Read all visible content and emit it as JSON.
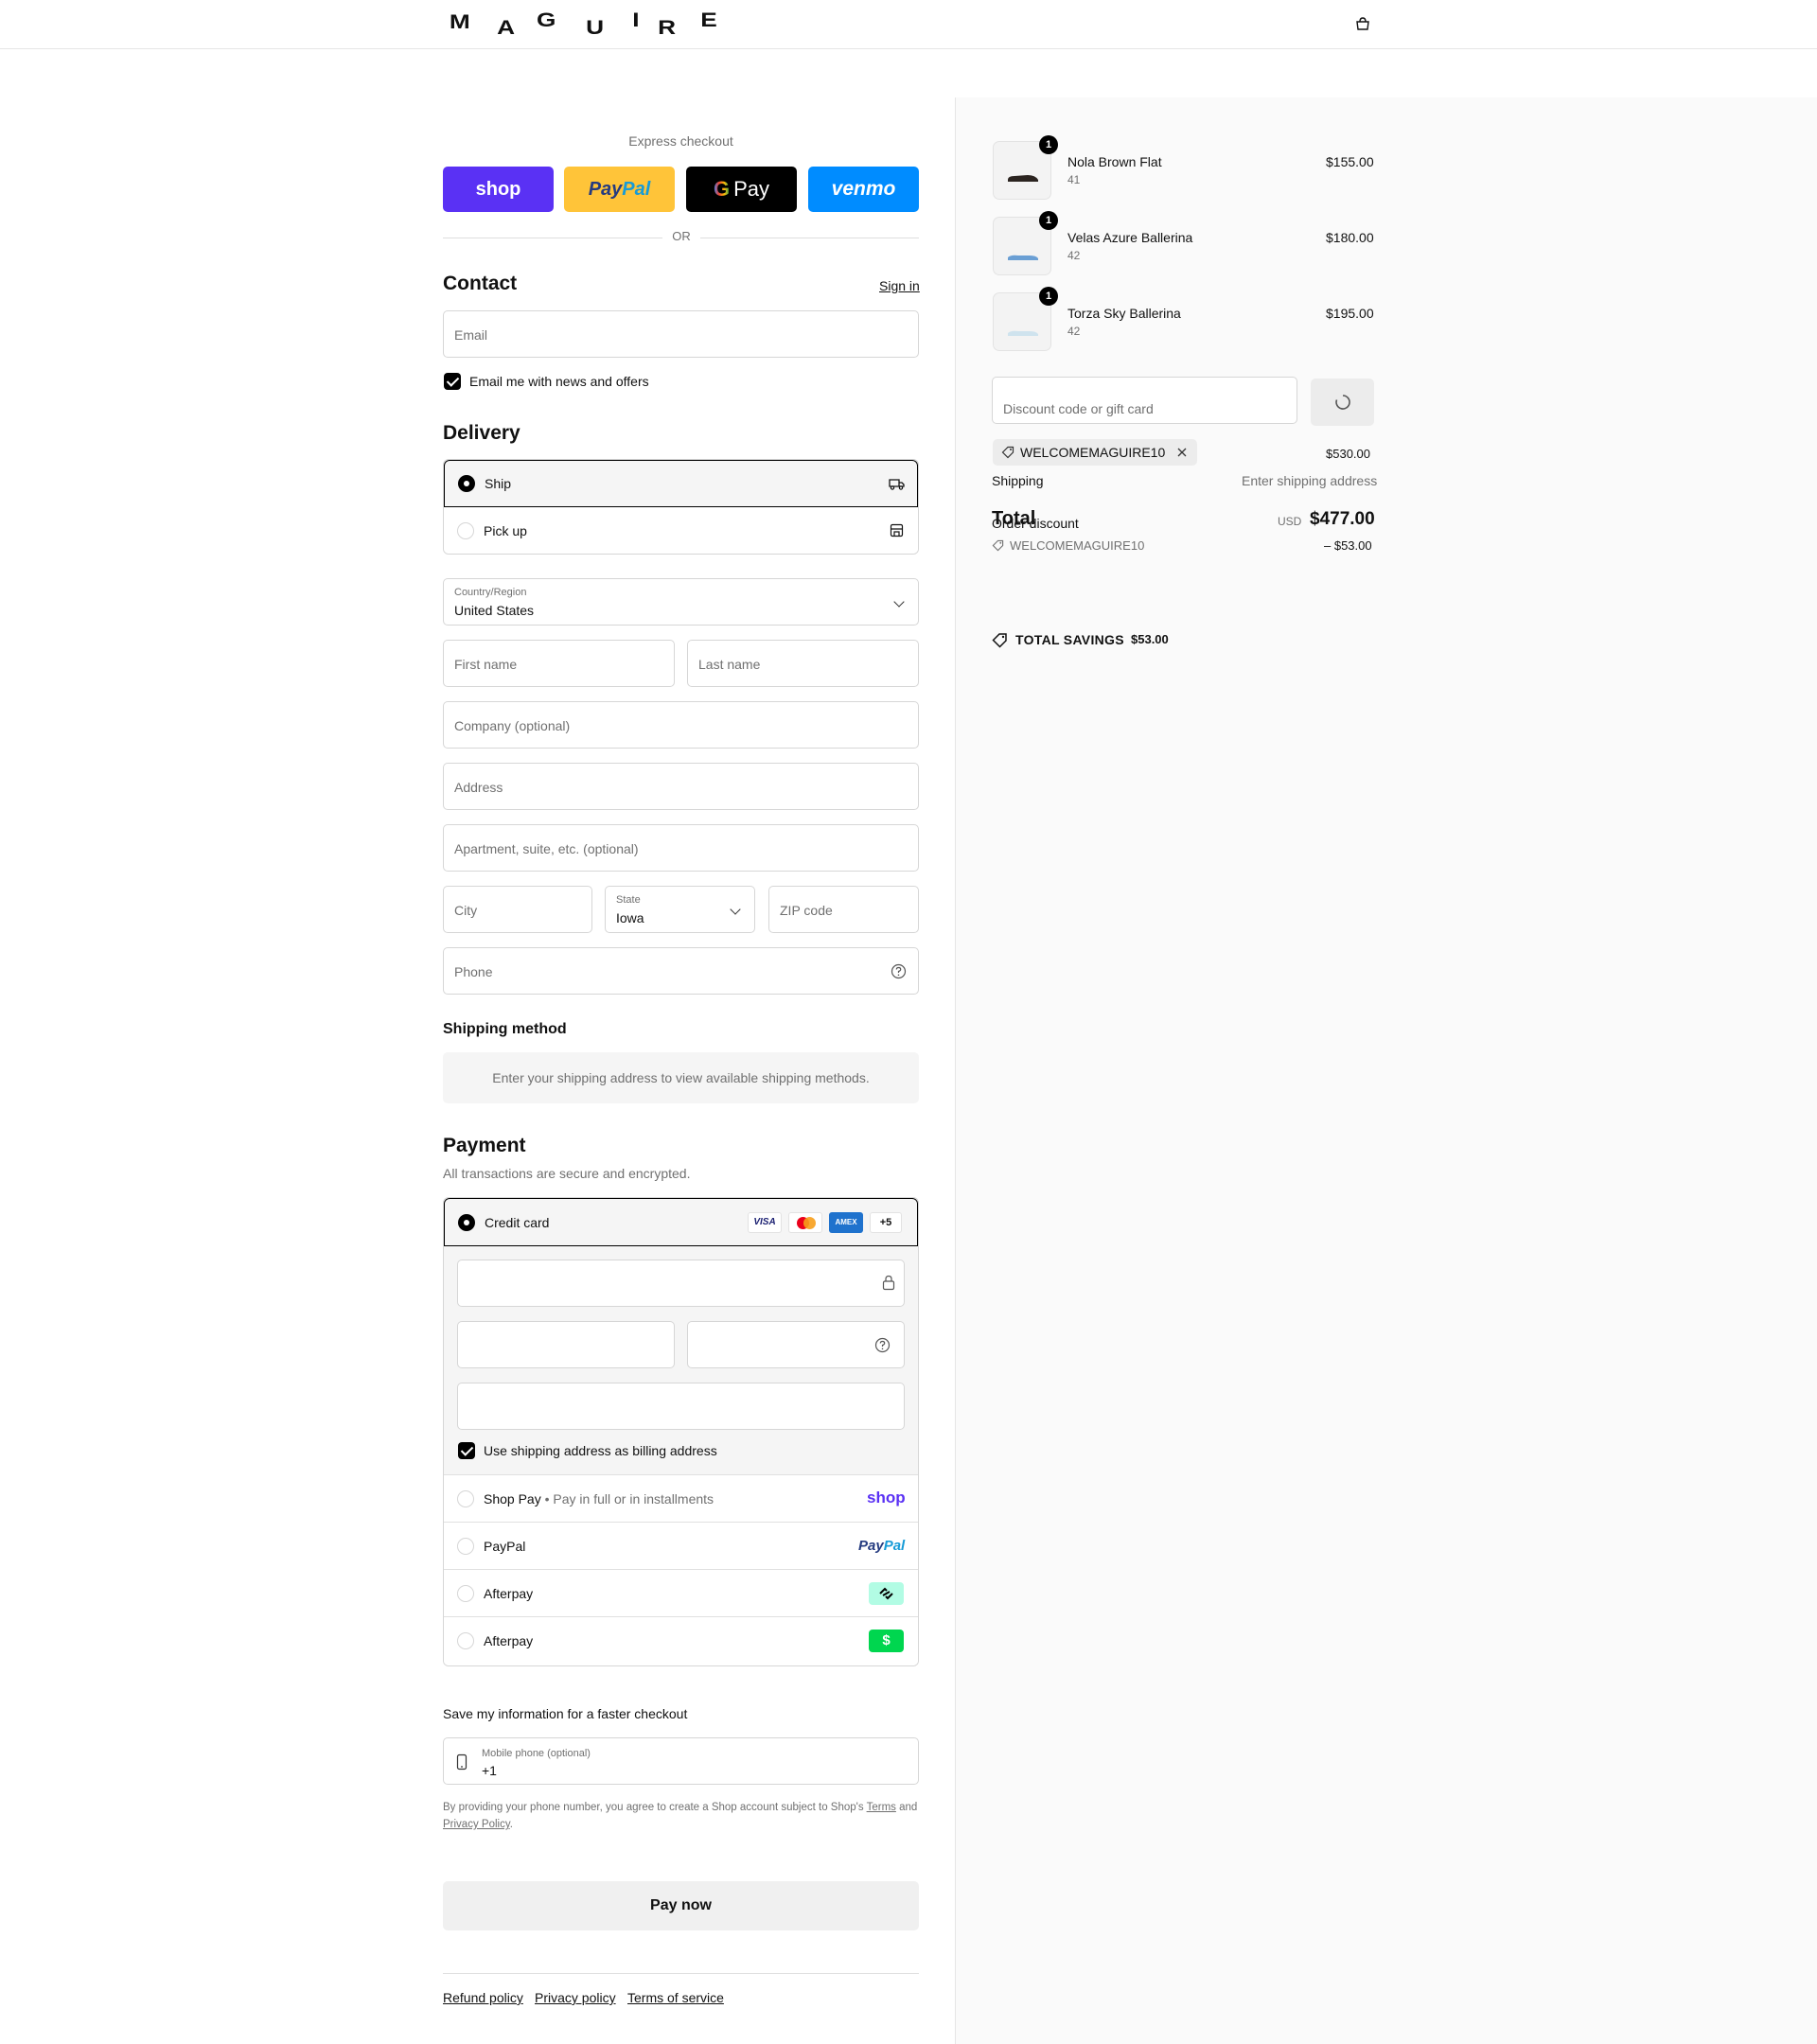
{
  "header": {
    "brand_letters": [
      "M",
      "A",
      "G",
      "U",
      "I",
      "R",
      "E"
    ]
  },
  "express": {
    "title": "Express checkout",
    "shop": "shop",
    "paypal_a": "Pay",
    "paypal_b": "Pal",
    "gpay": "Pay",
    "venmo": "venmo",
    "or": "OR"
  },
  "contact": {
    "title": "Contact",
    "sign_in": "Sign in",
    "email_placeholder": "Email",
    "news_label": "Email me with news and offers"
  },
  "delivery": {
    "title": "Delivery",
    "ship": "Ship",
    "pickup": "Pick up",
    "country_label": "Country/Region",
    "country_value": "United States",
    "first_name": "First name",
    "last_name": "Last name",
    "company": "Company (optional)",
    "address": "Address",
    "apartment": "Apartment, suite, etc. (optional)",
    "city": "City",
    "state_label": "State",
    "state_value": "Iowa",
    "zip": "ZIP code",
    "phone": "Phone"
  },
  "shipping_method": {
    "title": "Shipping method",
    "message": "Enter your shipping address to view available shipping methods."
  },
  "payment": {
    "title": "Payment",
    "subtitle": "All transactions are secure and encrypted.",
    "credit_card": "Credit card",
    "card_visa": "VISA",
    "card_amex": "AMEX",
    "card_more": "+5",
    "billing_same": "Use shipping address as billing address",
    "shop_pay": "Shop Pay",
    "shop_pay_note": "Pay in full or in installments",
    "shop_logo": "shop",
    "paypal": "PayPal",
    "paypal_logo_a": "Pay",
    "paypal_logo_b": "Pal",
    "afterpay_1": "Afterpay",
    "afterpay_2": "Afterpay",
    "cash_logo": "$"
  },
  "save_info": {
    "title": "Save my information for a faster checkout",
    "mobile_label": "Mobile phone (optional)",
    "mobile_value": "+1",
    "legal_1": "By providing your phone number, you agree to create a Shop account subject to Shop's",
    "terms": "Terms",
    "legal_and": "and",
    "privacy": "Privacy Policy",
    "legal_end": "."
  },
  "pay_now": "Pay now",
  "footer_links": [
    "Refund policy",
    "Privacy policy",
    "Terms of service"
  ],
  "summary": {
    "items": [
      {
        "name": "Nola Brown Flat",
        "variant": "41",
        "price": "$155.00",
        "qty": "1"
      },
      {
        "name": "Velas Azure Ballerina",
        "variant": "42",
        "price": "$180.00",
        "qty": "1"
      },
      {
        "name": "Torza Sky Ballerina",
        "variant": "42",
        "price": "$195.00",
        "qty": "1"
      }
    ],
    "discount_placeholder": "Discount code or gift card",
    "applied_code": "WELCOMEMAGUIRE10",
    "subtotal_value": "$530.00",
    "shipping_label": "Shipping",
    "shipping_value": "Enter shipping address",
    "total_label": "Total",
    "order_discount_label": "Order discount",
    "order_discount_code": "WELCOMEMAGUIRE10",
    "order_discount_value": "– $53.00",
    "currency": "USD",
    "total_value": "$477.00",
    "savings_label": "TOTAL SAVINGS",
    "savings_value": "$53.00"
  },
  "colors": {
    "shop": "#5a31f4",
    "paypal_bg": "#ffc439",
    "venmo": "#008cff",
    "gpay": "#000000",
    "afterpay": "#b2fce4",
    "cashapp": "#00d64f"
  }
}
